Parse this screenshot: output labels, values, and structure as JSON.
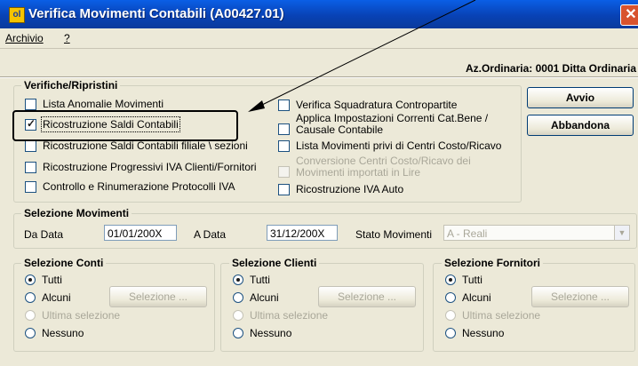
{
  "window": {
    "title": "Verifica Movimenti Contabili (A00427.01)",
    "icon": "app-icon",
    "close_glyph": "✕"
  },
  "menu": [
    "Archivio",
    "?"
  ],
  "company": "Az.Ordinaria: 0001 Ditta Ordinaria",
  "verifiche": {
    "title": "Verifiche/Ripristini",
    "left": [
      {
        "label": "Lista Anomalie Movimenti",
        "checked": false
      },
      {
        "label": "Ricostruzione Saldi Contabili",
        "checked": true
      },
      {
        "label": "Ricostruzione Saldi Contabili filiale \\ sezioni",
        "checked": false
      },
      {
        "label": "Ricostruzione Progressivi IVA Clienti/Fornitori",
        "checked": false
      },
      {
        "label": "Controllo e Rinumerazione Protocolli IVA",
        "checked": false
      }
    ],
    "right": [
      {
        "label": "Verifica Squadratura Contropartite",
        "checked": false
      },
      {
        "label": "Applica Impostazioni Correnti Cat.Bene /",
        "label2": "Causale Contabile",
        "checked": false
      },
      {
        "label": "Lista Movimenti privi di Centri Costo/Ricavo",
        "checked": false
      },
      {
        "label": "Conversione Centri Costo/Ricavo dei",
        "label2": "Movimenti importati in Lire",
        "checked": false,
        "disabled": true
      },
      {
        "label": "Ricostruzione IVA Auto",
        "checked": false
      }
    ]
  },
  "buttons": {
    "avvio": "Avvio",
    "abbandona": "Abbandona"
  },
  "movimenti": {
    "title": "Selezione Movimenti",
    "da_label": "Da Data",
    "da_value": "01/01/200X",
    "a_label": "A Data",
    "a_value": "31/12/200X",
    "stato_label": "Stato Movimenti",
    "stato_value": "A - Reali"
  },
  "sections": [
    {
      "title": "Selezione Conti",
      "options": [
        "Tutti",
        "Alcuni",
        "Ultima selezione",
        "Nessuno"
      ],
      "button": "Selezione ..."
    },
    {
      "title": "Selezione Clienti",
      "options": [
        "Tutti",
        "Alcuni",
        "Ultima selezione",
        "Nessuno"
      ],
      "button": "Selezione ..."
    },
    {
      "title": "Selezione Fornitori",
      "options": [
        "Tutti",
        "Alcuni",
        "Ultima selezione",
        "Nessuno"
      ],
      "button": "Selezione ..."
    }
  ]
}
